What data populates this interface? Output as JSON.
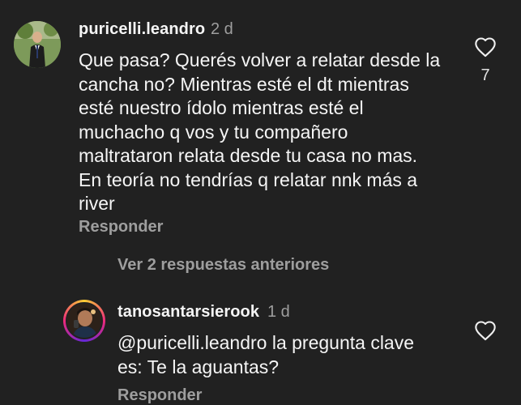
{
  "comment": {
    "username": "puricelli.leandro",
    "time": "2 d",
    "text": "Que pasa? Querés volver a relatar desde la\ncancha no? Mientras esté el dt mientras\nesté nuestro ídolo mientras esté el\nmuchacho q vos y tu compañero\nmaltrataron relata desde tu casa no mas.\nEn teoría no tendrías q relatar nnk más a\nriver",
    "reply_label": "Responder",
    "like_count": "7"
  },
  "more_replies_label": "Ver 2 respuestas anteriores",
  "reply": {
    "username": "tanosantarsierook",
    "time": "1 d",
    "mention": "@puricelli.leandro",
    "text_line1": " la pregunta clave",
    "text_line2": "es: Te la aguantas?",
    "reply_label": "Responder"
  }
}
